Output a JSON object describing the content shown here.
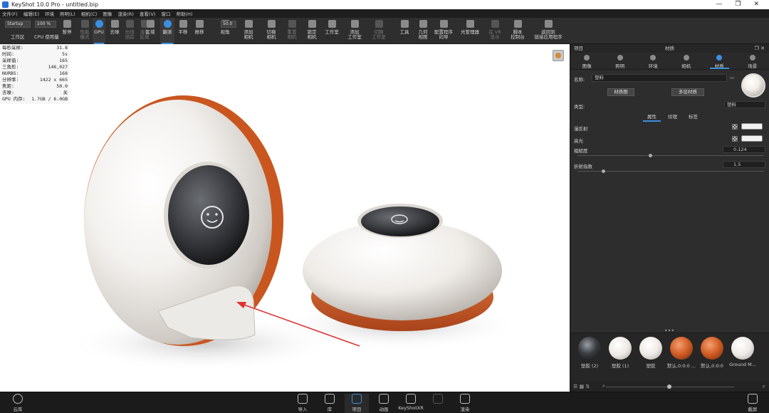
{
  "window": {
    "title": "KeyShot 10.0 Pro - untitled.bip",
    "controls": [
      "—",
      "❐",
      "✕"
    ]
  },
  "menu": [
    "文件(F)",
    "编辑(E)",
    "环境",
    "照明(L)",
    "相机(C)",
    "图像",
    "渲染(R)",
    "查看(V)",
    "窗口",
    "帮助(H)"
  ],
  "ribbon": {
    "workspace_select": "Startup",
    "zoom_value": "100 %",
    "fov_value": "50.0",
    "workspace_label": "工作区",
    "cpu_label": "CPU 使用量",
    "pause_label": "暂停",
    "buttons": [
      {
        "label": "性能\n模式",
        "dim": true
      },
      {
        "label": "GPU",
        "active": true,
        "blue": true
      },
      {
        "label": "去噪"
      },
      {
        "label": "光线\n追踪",
        "dim": true
      },
      {
        "label": "渲染\n区域",
        "dim": true
      },
      {
        "label": "区域"
      },
      {
        "label": "翻滚",
        "active": true,
        "blue": true
      },
      {
        "label": "平移"
      },
      {
        "label": "推移"
      },
      {
        "label": "视角"
      },
      {
        "label": "添加\n相机"
      },
      {
        "label": "切换\n相机"
      },
      {
        "label": "重置\n相机",
        "dim": true
      },
      {
        "label": "锁定\n相机"
      },
      {
        "label": "工作室"
      },
      {
        "label": "添加\n工作室"
      },
      {
        "label": "切换\n工作室",
        "dim": true
      },
      {
        "label": "工具"
      },
      {
        "label": "几何\n视图"
      },
      {
        "label": "配置程序\n向导"
      },
      {
        "label": "光管理器"
      },
      {
        "label": "在 VR\n显示",
        "dim": true
      },
      {
        "label": "脚本\n控制台"
      },
      {
        "label": "返回到\n链接应用程序"
      }
    ]
  },
  "hud": {
    "rows": [
      {
        "label": "每秒采样:",
        "value": "31.8"
      },
      {
        "label": "时间:",
        "value": "5s"
      },
      {
        "label": "采样值:",
        "value": "165"
      },
      {
        "label": "三角形:",
        "value": "146,027"
      },
      {
        "label": "NURBS:",
        "value": "168"
      },
      {
        "label": "分辨率:",
        "value": "1422 x 665"
      },
      {
        "label": "焦距:",
        "value": "50.0"
      },
      {
        "label": "去噪:",
        "value": "关"
      },
      {
        "label": "GPU 内存:",
        "value": "1.7GB / 6.0GB"
      }
    ]
  },
  "panel": {
    "left_title": "项目",
    "title": "材质",
    "tabs": [
      "图像",
      "照明",
      "环境",
      "相机",
      "材质",
      "场景"
    ],
    "active_tab": 4,
    "name_label": "名称:",
    "name_value": "塑料",
    "material_graph_button": "材质图",
    "multi_material_button": "多层材质",
    "type_label": "类型:",
    "type_value": "塑料",
    "subtabs": [
      "属性",
      "纹理",
      "标签"
    ],
    "props": {
      "diffuse_label": "漫反射",
      "specular_label": "高光",
      "roughness_label": "粗糙度",
      "roughness_value": "0.124",
      "roughness_fraction": 0.38,
      "ior_label": "折射指数",
      "ior_value": "1.5",
      "ior_fraction": 0.13
    }
  },
  "library": {
    "materials": [
      {
        "name": "塑胶 (2)",
        "color": "dark-glass"
      },
      {
        "name": "塑胶 (1)",
        "color": "white"
      },
      {
        "name": "塑胶",
        "color": "white"
      },
      {
        "name": "默认,0:0:0 ...",
        "color": "orange"
      },
      {
        "name": "默认,0:0:0",
        "color": "orange"
      },
      {
        "name": "Ground M...",
        "color": "white"
      }
    ]
  },
  "bottombar": {
    "cloud_label": "云库",
    "buttons": [
      {
        "label": "导入"
      },
      {
        "label": "库"
      },
      {
        "label": "项目",
        "active": true
      },
      {
        "label": "动画"
      },
      {
        "label": "KeyShotXR"
      },
      {
        "label": "",
        "dim": true
      },
      {
        "label": "渲染"
      }
    ],
    "screenshot_label": "截屏"
  },
  "colors": {
    "accent": "#3b8fe0",
    "orange_base": "#c8561f",
    "product_white": "#f3f1ee"
  }
}
